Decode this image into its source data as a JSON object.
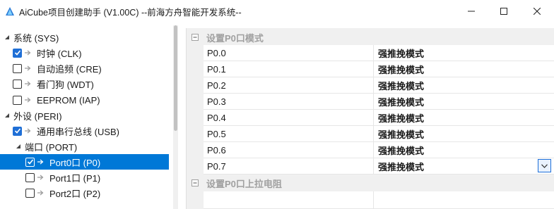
{
  "window": {
    "title": "AiCube项目创建助手 (V1.00C) --前海方舟智能开发系统--"
  },
  "tree": {
    "items": [
      {
        "label": "系统 (SYS)",
        "level": 0,
        "expanded": true,
        "checkbox": false
      },
      {
        "label": "时钟 (CLK)",
        "level": 1,
        "checkbox": true,
        "checked": true
      },
      {
        "label": "自动追频 (CRE)",
        "level": 1,
        "checkbox": true,
        "checked": false
      },
      {
        "label": "看门狗 (WDT)",
        "level": 1,
        "checkbox": true,
        "checked": false
      },
      {
        "label": "EEPROM (IAP)",
        "level": 1,
        "checkbox": true,
        "checked": false
      },
      {
        "label": "外设 (PERI)",
        "level": 0,
        "expanded": true,
        "checkbox": false
      },
      {
        "label": "通用串行总线 (USB)",
        "level": 1,
        "checkbox": true,
        "checked": true
      },
      {
        "label": "端口 (PORT)",
        "level": 1,
        "expanded": true,
        "checkbox": false
      },
      {
        "label": "Port0口 (P0)",
        "level": 2,
        "checkbox": true,
        "checked": true,
        "selected": true
      },
      {
        "label": "Port1口 (P1)",
        "level": 2,
        "checkbox": true,
        "checked": false
      },
      {
        "label": "Port2口 (P2)",
        "level": 2,
        "checkbox": true,
        "checked": false
      }
    ]
  },
  "propgrid": {
    "category1": "设置P0口模式",
    "category2": "设置P0口上拉电阻",
    "rows": [
      {
        "name": "P0.0",
        "value": "强推挽模式"
      },
      {
        "name": "P0.1",
        "value": "强推挽模式"
      },
      {
        "name": "P0.2",
        "value": "强推挽模式"
      },
      {
        "name": "P0.3",
        "value": "强推挽模式"
      },
      {
        "name": "P0.4",
        "value": "强推挽模式"
      },
      {
        "name": "P0.5",
        "value": "强推挽模式"
      },
      {
        "name": "P0.6",
        "value": "强推挽模式"
      },
      {
        "name": "P0.7",
        "value": "强推挽模式"
      }
    ]
  },
  "colors": {
    "selection": "#0078d7",
    "checkbox_checked": "#1f6fd6",
    "category_text": "#a0a0a0"
  }
}
